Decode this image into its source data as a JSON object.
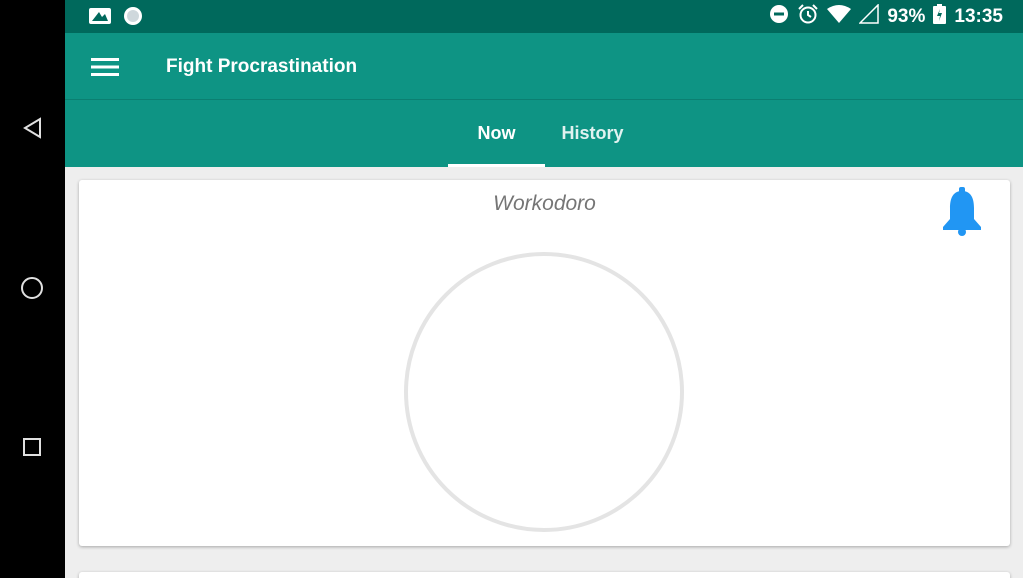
{
  "system_nav": {
    "back_icon": "back-triangle-icon",
    "home_icon": "home-circle-icon",
    "recents_icon": "recents-square-icon"
  },
  "statusbar": {
    "battery": "93%",
    "time": "13:35",
    "icons": [
      "dnd-icon",
      "alarm-icon",
      "wifi-icon",
      "signal-icon",
      "battery-icon"
    ]
  },
  "appbar": {
    "title": "Fight Procrastination",
    "menu_icon": "hamburger-menu-icon",
    "color": "#0e9484"
  },
  "tabs": [
    {
      "label": "Now",
      "selected": true
    },
    {
      "label": "History",
      "selected": false
    }
  ],
  "card": {
    "title": "Workodoro",
    "bell_color": "#2196f3",
    "bell_icon": "bell-icon"
  }
}
